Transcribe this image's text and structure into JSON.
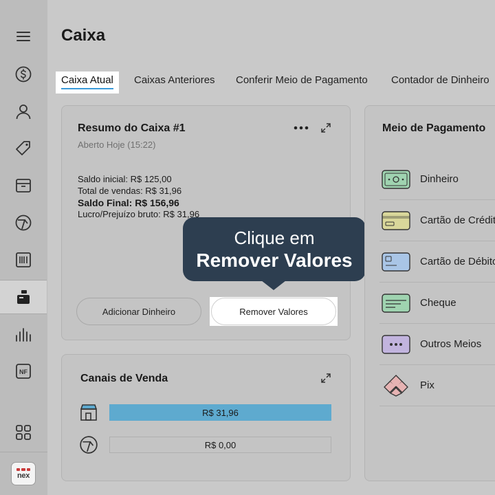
{
  "sidebar": {
    "items": [
      {
        "icon": "menu-icon"
      },
      {
        "icon": "dollar-icon"
      },
      {
        "icon": "user-icon"
      },
      {
        "icon": "tag-icon"
      },
      {
        "icon": "box-icon"
      },
      {
        "icon": "channel-icon"
      },
      {
        "icon": "barcode-icon"
      },
      {
        "icon": "cash-register-icon",
        "active": true
      },
      {
        "icon": "chart-bars-icon"
      },
      {
        "icon": "nf-icon",
        "text": "NF"
      },
      {
        "icon": "grid-icon"
      }
    ],
    "logo_text": "nex"
  },
  "page": {
    "title": "Caixa"
  },
  "tabs": [
    {
      "label": "Caixa Atual",
      "active": true
    },
    {
      "label": "Caixas Anteriores"
    },
    {
      "label": "Conferir Meio de Pagamento"
    },
    {
      "label": "Contador de Dinheiro"
    }
  ],
  "summary": {
    "title": "Resumo do Caixa #1",
    "subtitle": "Aberto Hoje (15:22)",
    "lines": [
      "Saldo inicial: R$ 125,00",
      "Total de vendas: R$ 31,96",
      "Saldo Final: R$ 156,96",
      "Lucro/Prejuízo bruto: R$ 31,96"
    ],
    "add_label": "Adicionar Dinheiro",
    "remove_label": "Remover Valores"
  },
  "tooltip": {
    "line1": "Clique em",
    "line2": "Remover Valores"
  },
  "channels": {
    "title": "Canais de Venda",
    "rows": [
      {
        "icon": "store-icon",
        "value": "R$ 31,96",
        "fill": 1.0
      },
      {
        "icon": "channel-icon",
        "value": "R$ 0,00",
        "fill": 0.0
      }
    ]
  },
  "payment": {
    "title": "Meio de Pagamento",
    "methods": [
      {
        "icon": "cash-icon",
        "label": "Dinheiro",
        "color": "#9fd3b0"
      },
      {
        "icon": "credit-card-icon",
        "label": "Cartão de Crédito",
        "color": "#d9d79a"
      },
      {
        "icon": "debit-card-icon",
        "label": "Cartão de Débito",
        "color": "#a9c5e6"
      },
      {
        "icon": "cheque-icon",
        "label": "Cheque",
        "color": "#9fd3b0"
      },
      {
        "icon": "dots-icon",
        "label": "Outros Meios",
        "color": "#c2b4de"
      },
      {
        "icon": "pix-icon",
        "label": "Pix",
        "color": "#e6b3b3"
      }
    ]
  }
}
